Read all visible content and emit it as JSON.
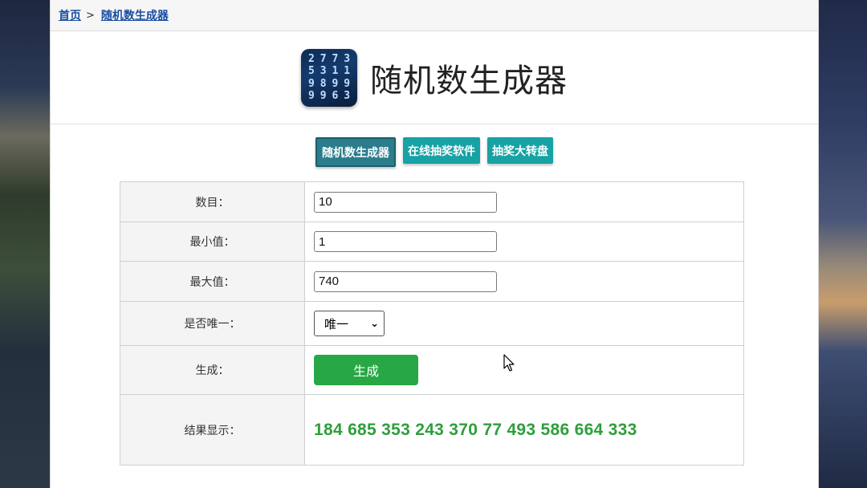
{
  "breadcrumb": {
    "home": "首页",
    "separator": ">",
    "current": "随机数生成器"
  },
  "header": {
    "title": "随机数生成器",
    "logo_digits": [
      "2",
      "7",
      "7",
      "3",
      "5",
      "3",
      "1",
      "1",
      "9",
      "8",
      "9",
      "9",
      "9",
      "9",
      "6",
      "3"
    ]
  },
  "tabs": [
    {
      "label": "随机数生成器",
      "active": true
    },
    {
      "label": "在线抽奖软件",
      "active": false
    },
    {
      "label": "抽奖大转盘",
      "active": false
    }
  ],
  "form": {
    "count": {
      "label": "数目：",
      "value": "10"
    },
    "min": {
      "label": "最小值：",
      "value": "1"
    },
    "max": {
      "label": "最大值：",
      "value": "740"
    },
    "unique": {
      "label": "是否唯一：",
      "selected": "唯一"
    },
    "generate": {
      "label": "生成：",
      "button": "生成"
    },
    "result": {
      "label": "结果显示：",
      "value": "184 685 353 243 370 77 493 586 664 333"
    }
  },
  "colors": {
    "tab": "#17a2a5",
    "button": "#28a745",
    "result": "#2e9e3c",
    "link": "#1a4d9e"
  }
}
